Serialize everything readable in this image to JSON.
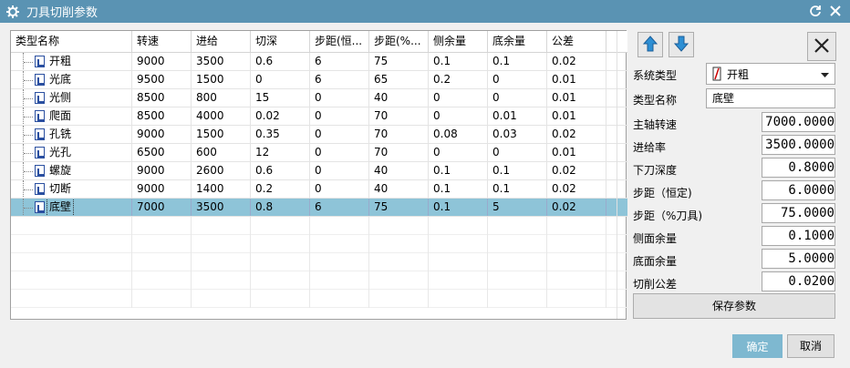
{
  "window": {
    "title": "刀具切削参数"
  },
  "table": {
    "columns": [
      "类型名称",
      "转速",
      "进给",
      "切深",
      "步距(恒...",
      "步距(%...",
      "侧余量",
      "底余量",
      "公差"
    ],
    "rows": [
      [
        "开粗",
        "9000",
        "3500",
        "0.6",
        "6",
        "75",
        "0.1",
        "0.1",
        "0.02"
      ],
      [
        "光底",
        "9500",
        "1500",
        "0",
        "6",
        "65",
        "0.2",
        "0",
        "0.01"
      ],
      [
        "光侧",
        "8500",
        "800",
        "15",
        "0",
        "40",
        "0",
        "0",
        "0.01"
      ],
      [
        "爬面",
        "8500",
        "4000",
        "0.02",
        "0",
        "70",
        "0",
        "0.01",
        "0.01"
      ],
      [
        "孔铣",
        "9000",
        "1500",
        "0.35",
        "0",
        "70",
        "0.08",
        "0.03",
        "0.02"
      ],
      [
        "光孔",
        "6500",
        "600",
        "12",
        "0",
        "70",
        "0",
        "0",
        "0.01"
      ],
      [
        "螺旋",
        "9000",
        "2600",
        "0.6",
        "0",
        "40",
        "0.1",
        "0.1",
        "0.02"
      ],
      [
        "切断",
        "9000",
        "1400",
        "0.2",
        "0",
        "40",
        "0.1",
        "0.1",
        "0.02"
      ],
      [
        "底壁",
        "7000",
        "3500",
        "0.8",
        "6",
        "75",
        "0.1",
        "5",
        "0.02"
      ]
    ],
    "selected_index": 8
  },
  "panel": {
    "system_type_label": "系统类型",
    "system_type_value": "开粗",
    "type_name_label": "类型名称",
    "type_name_value": "底壁",
    "fields": [
      {
        "label": "主轴转速",
        "value": "7000.0000"
      },
      {
        "label": "进给率",
        "value": "3500.0000"
      },
      {
        "label": "下刀深度",
        "value": "0.8000"
      },
      {
        "label": "步距（恒定)",
        "value": "6.0000"
      },
      {
        "label": "步距（%刀具)",
        "value": "75.0000"
      },
      {
        "label": "侧面余量",
        "value": "0.1000"
      },
      {
        "label": "底面余量",
        "value": "5.0000"
      },
      {
        "label": "切削公差",
        "value": "0.0200"
      }
    ],
    "save_label": "保存参数"
  },
  "footer": {
    "ok_label": "确定",
    "cancel_label": "取消"
  },
  "colors": {
    "titlebar": "#5a93b3",
    "selected_row": "#8ec4d8",
    "ok_button": "#7eb8d0",
    "arrow_blue": "#2d8fd4"
  },
  "icons": {
    "title": "gear-icon",
    "reset": "reset-icon",
    "close": "close-icon",
    "up": "arrow-up-icon",
    "down": "arrow-down-icon",
    "delete": "x-icon",
    "row": "operation-icon"
  }
}
